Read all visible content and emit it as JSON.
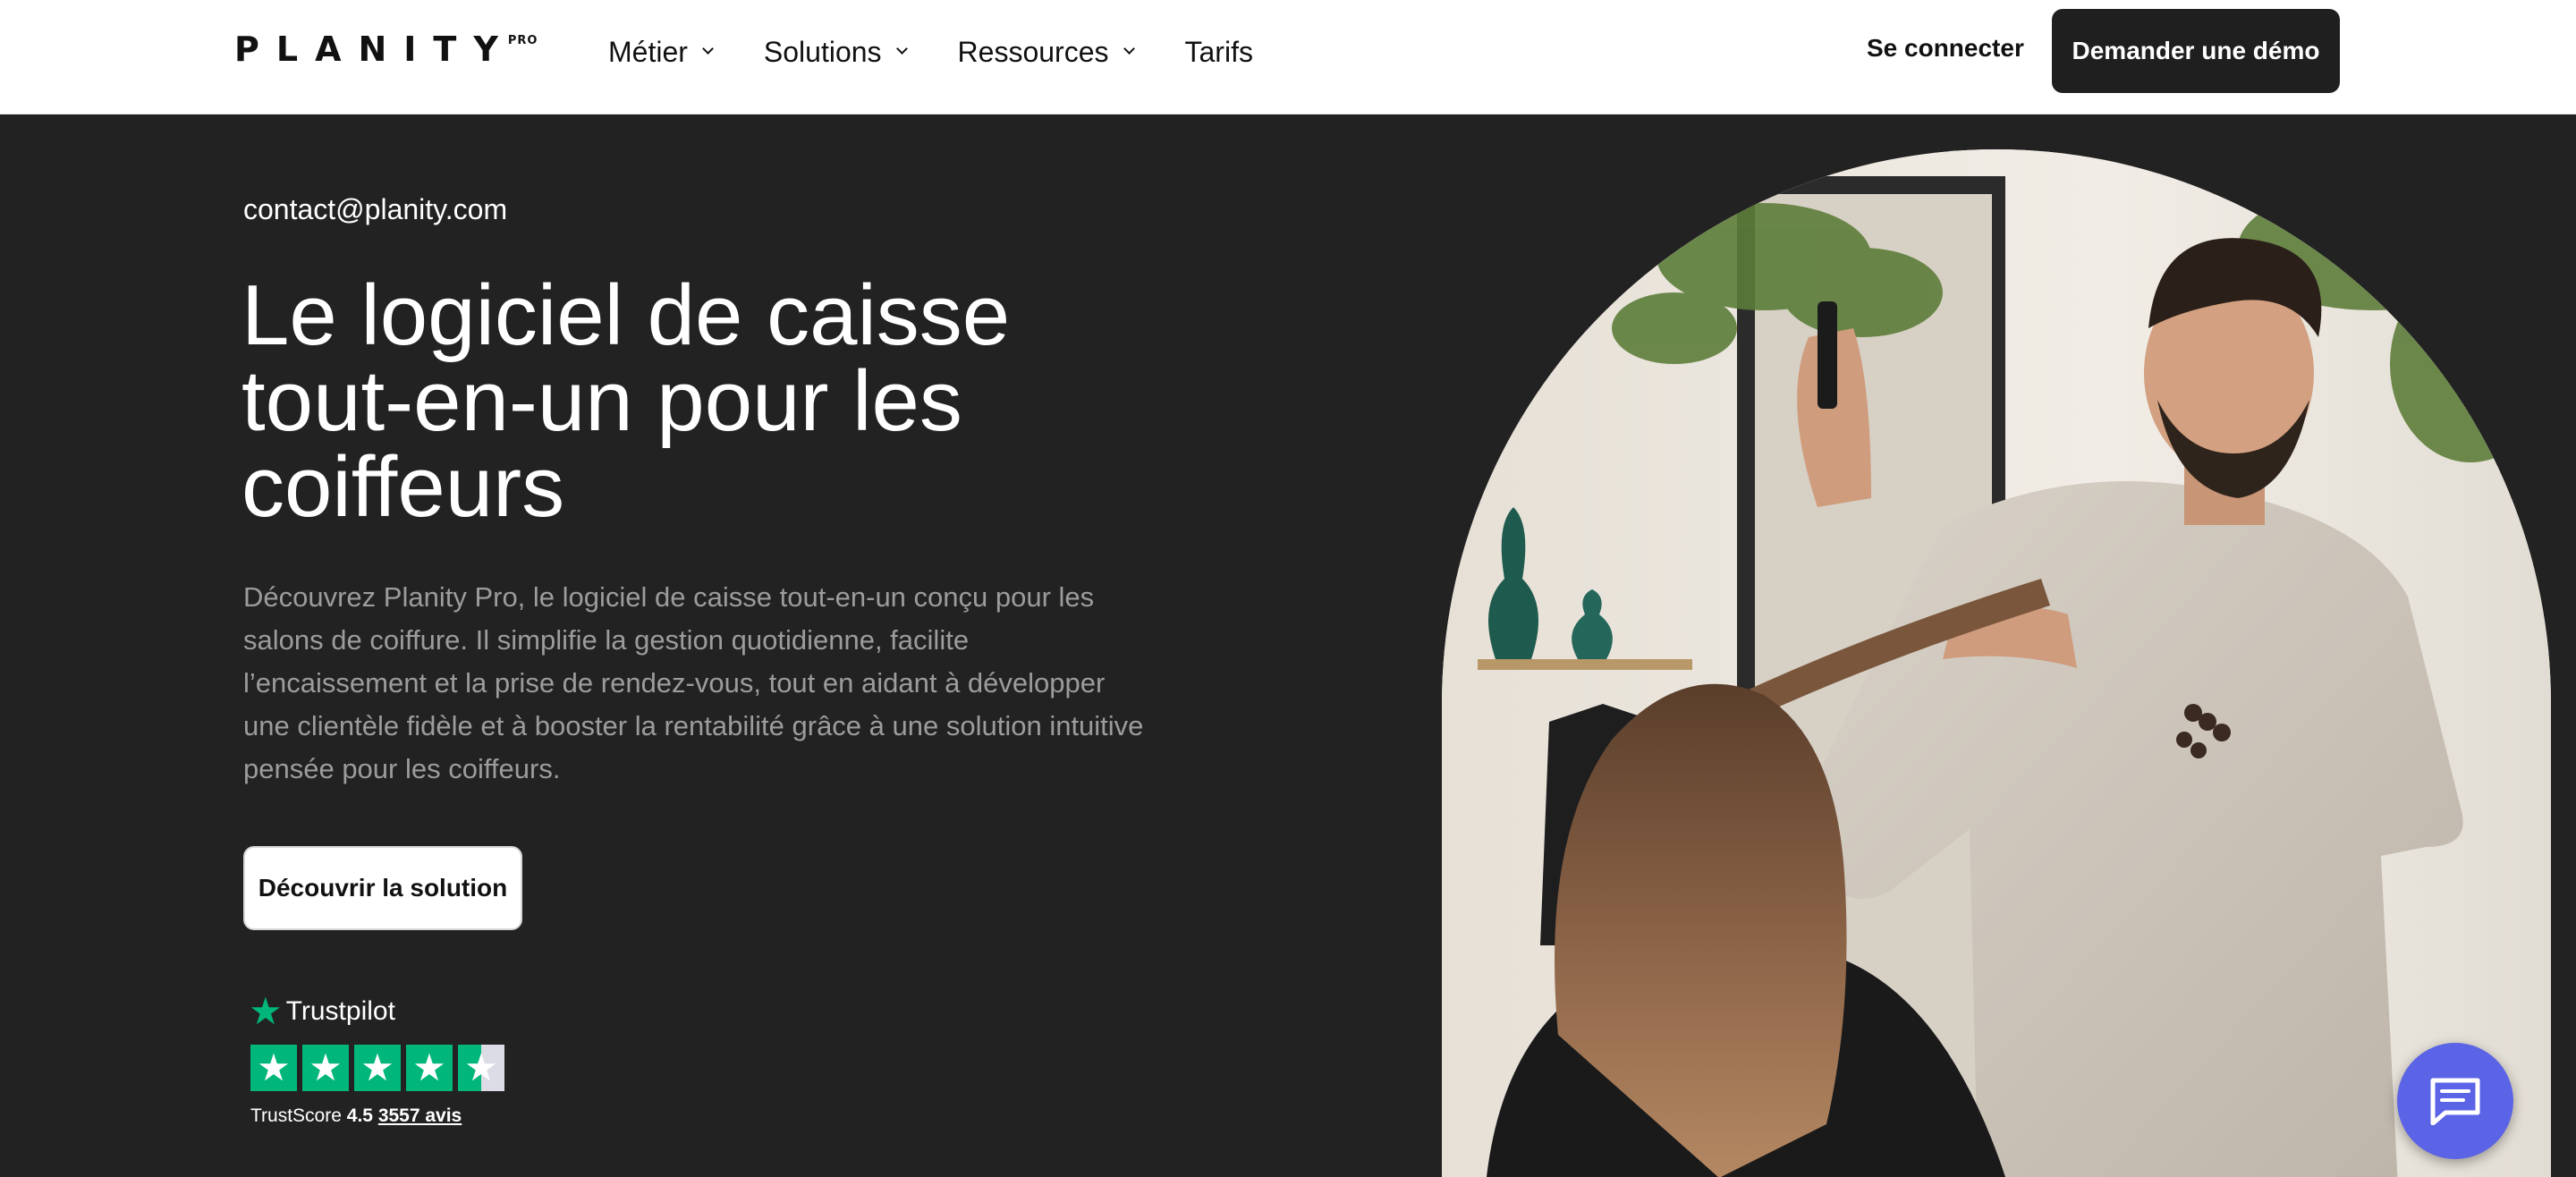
{
  "header": {
    "logo": "PLANITY",
    "logo_badge": "PRO",
    "nav": [
      {
        "label": "Métier",
        "dropdown": true
      },
      {
        "label": "Solutions",
        "dropdown": true
      },
      {
        "label": "Ressources",
        "dropdown": true
      },
      {
        "label": "Tarifs",
        "dropdown": false
      }
    ],
    "login": "Se connecter",
    "demo": "Demander une démo"
  },
  "hero": {
    "email": "contact@planity.com",
    "title": "Le logiciel de caisse tout-en-un pour les coiffeurs",
    "description": "Découvrez Planity Pro, le logiciel de caisse tout-en-un conçu pour les salons de coiffure. Il simplifie la gestion quotidienne, facilite l’encaissement et la prise de rendez-vous, tout en aidant à développer une clientèle fidèle et à booster la rentabilité grâce à une solution intuitive pensée pour les coiffeurs.",
    "cta": "Découvrir la solution"
  },
  "trustpilot": {
    "brand": "Trustpilot",
    "score_label": "TrustScore",
    "score": "4.5",
    "reviews": "3557 avis",
    "rating": 4.5,
    "max_rating": 5
  },
  "colors": {
    "background": "#222222",
    "trustpilot_green": "#00b67a",
    "chat_button": "#5b63e6"
  },
  "icons": {
    "chat": "chat-bubble-icon",
    "trustpilot": "star-icon"
  }
}
